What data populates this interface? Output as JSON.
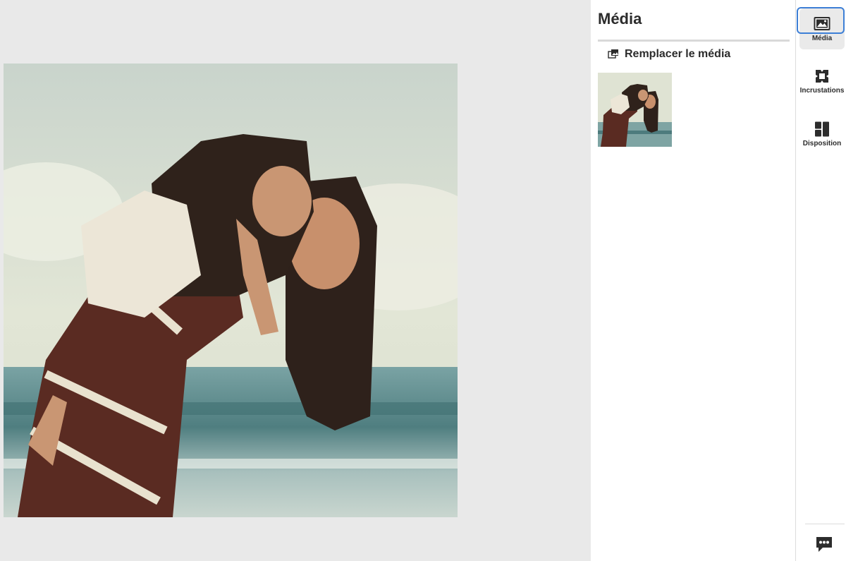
{
  "panel": {
    "title": "Média",
    "replace_label": "Remplacer le média"
  },
  "rail": {
    "tabs": [
      {
        "label": "Média",
        "icon": "image-icon",
        "active": true
      },
      {
        "label": "Incrustations",
        "icon": "overlays-icon",
        "active": false
      },
      {
        "label": "Disposition",
        "icon": "layout-icon",
        "active": false
      }
    ],
    "feedback_icon": "feedback-icon"
  },
  "colors": {
    "accent": "#3d7fd6",
    "canvas_bg": "#e9e9e9",
    "rail_active_bg": "#eaeaea"
  }
}
